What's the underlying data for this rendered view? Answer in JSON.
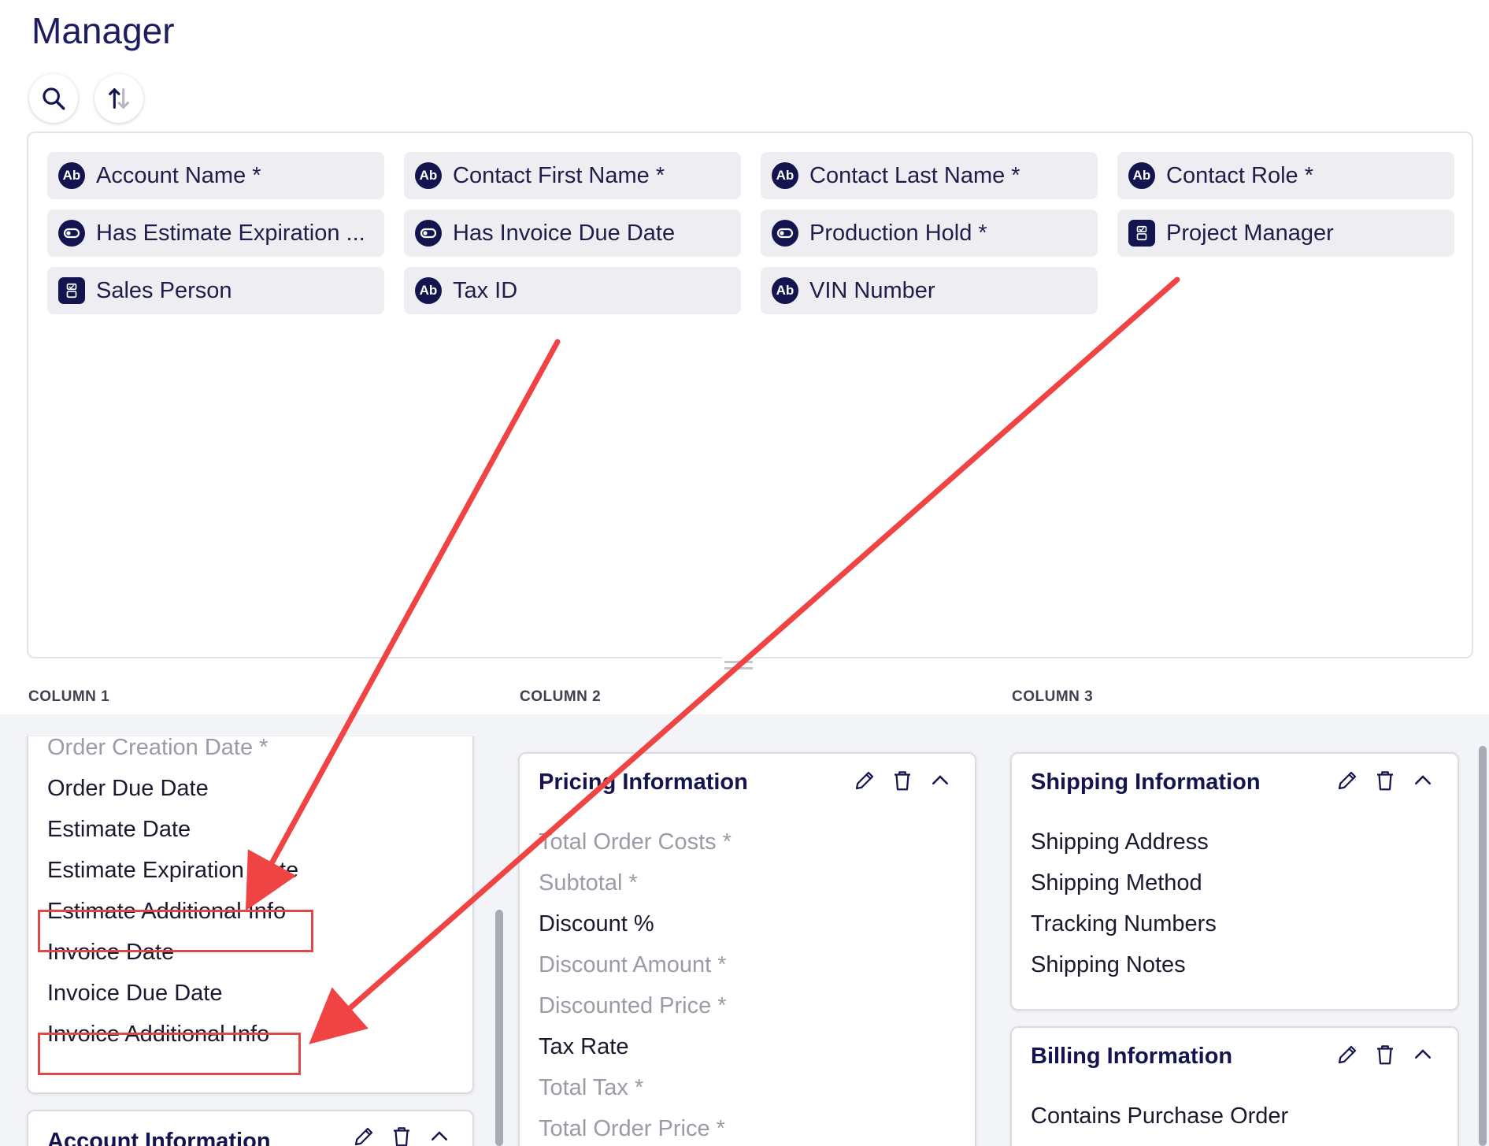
{
  "page": {
    "title": "Manager"
  },
  "toolbar": {
    "search_icon": "search-icon",
    "sort_icon": "sort-icon"
  },
  "fields": [
    {
      "label": "Account Name *",
      "icon": "Ab",
      "type": "text"
    },
    {
      "label": "Contact First Name *",
      "icon": "Ab",
      "type": "text"
    },
    {
      "label": "Contact Last Name *",
      "icon": "Ab",
      "type": "text"
    },
    {
      "label": "Contact Role *",
      "icon": "Ab",
      "type": "text"
    },
    {
      "label": "Has Estimate Expiration ...",
      "icon": "toggle-icon",
      "type": "toggle"
    },
    {
      "label": "Has Invoice Due Date",
      "icon": "toggle-icon",
      "type": "toggle"
    },
    {
      "label": "Production Hold *",
      "icon": "toggle-icon",
      "type": "toggle"
    },
    {
      "label": "Project Manager",
      "icon": "select-list-icon",
      "type": "list"
    },
    {
      "label": "Sales Person",
      "icon": "select-list-icon",
      "type": "list"
    },
    {
      "label": "Tax ID",
      "icon": "Ab",
      "type": "text"
    },
    {
      "label": "VIN Number",
      "icon": "Ab",
      "type": "text"
    }
  ],
  "columns": {
    "c1": "COLUMN 1",
    "c2": "COLUMN 2",
    "c3": "COLUMN 3"
  },
  "column1": {
    "card_fields": [
      {
        "label": "Order Creation Date *",
        "required": true
      },
      {
        "label": "Order Due Date",
        "required": false
      },
      {
        "label": "Estimate Date",
        "required": false
      },
      {
        "label": "Estimate Expiration Date",
        "required": false
      },
      {
        "label": "Estimate Additional Info",
        "required": false
      },
      {
        "label": "Invoice Date",
        "required": false
      },
      {
        "label": "Invoice Due Date",
        "required": false
      },
      {
        "label": "Invoice Additional Info",
        "required": false
      }
    ],
    "next_card_title": "Account Information"
  },
  "column2": {
    "pricing": {
      "title": "Pricing Information",
      "fields": [
        {
          "label": "Total Order Costs *",
          "required": true
        },
        {
          "label": "Subtotal *",
          "required": true
        },
        {
          "label": "Discount %",
          "required": false
        },
        {
          "label": "Discount Amount *",
          "required": true
        },
        {
          "label": "Discounted Price *",
          "required": true
        },
        {
          "label": "Tax Rate",
          "required": false
        },
        {
          "label": "Total Tax *",
          "required": true
        },
        {
          "label": "Total Order Price *",
          "required": true
        }
      ]
    }
  },
  "column3": {
    "shipping": {
      "title": "Shipping Information",
      "fields": [
        "Shipping Address",
        "Shipping Method",
        "Tracking Numbers",
        "Shipping Notes"
      ]
    },
    "billing": {
      "title": "Billing Information",
      "fields": [
        "Contains Purchase Order"
      ]
    }
  },
  "colors": {
    "accent": "#14154f",
    "annotation": "#f04444"
  }
}
